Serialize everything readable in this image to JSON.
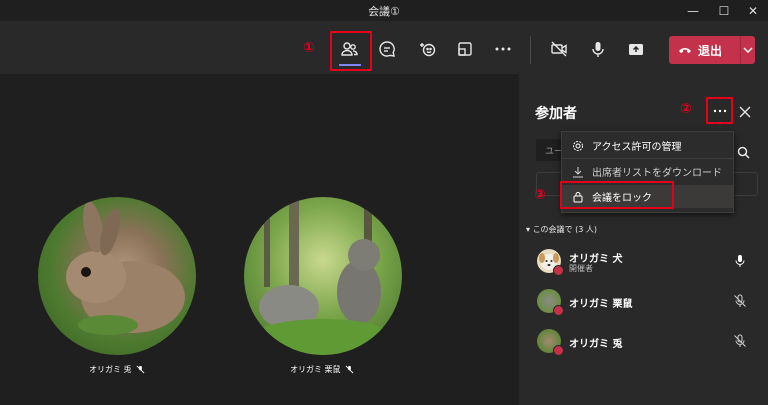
{
  "window": {
    "title": "会議①"
  },
  "toolbar": {
    "leave_label": "退出",
    "icons": [
      "participants-icon",
      "chat-icon",
      "reactions-icon",
      "share-tray-icon",
      "more-icon",
      "camera-off-icon",
      "mic-icon",
      "share-screen-icon"
    ]
  },
  "annotations": {
    "one": "①",
    "two": "②",
    "three": "③"
  },
  "videos": [
    {
      "name": "オリガミ 兎"
    },
    {
      "name": "オリガミ 栗鼠"
    }
  ],
  "panel": {
    "title": "参加者",
    "search_placeholder": "ユー",
    "section": "この会議で (3 人)",
    "menu": [
      {
        "label": "アクセス許可の管理",
        "icon": "gear-icon"
      },
      {
        "label": "出席者リストをダウンロード",
        "icon": "download-icon"
      },
      {
        "label": "会議をロック",
        "icon": "lock-icon"
      }
    ],
    "participants": [
      {
        "name": "オリガミ 犬",
        "role": "開催者",
        "mic": "on"
      },
      {
        "name": "オリガミ 栗鼠",
        "role": "",
        "mic": "off"
      },
      {
        "name": "オリガミ 兎",
        "role": "",
        "mic": "off"
      }
    ]
  },
  "colors": {
    "accent_red": "#e3001b",
    "leave_red": "#c4314b",
    "active_underline": "#7f85f5"
  }
}
